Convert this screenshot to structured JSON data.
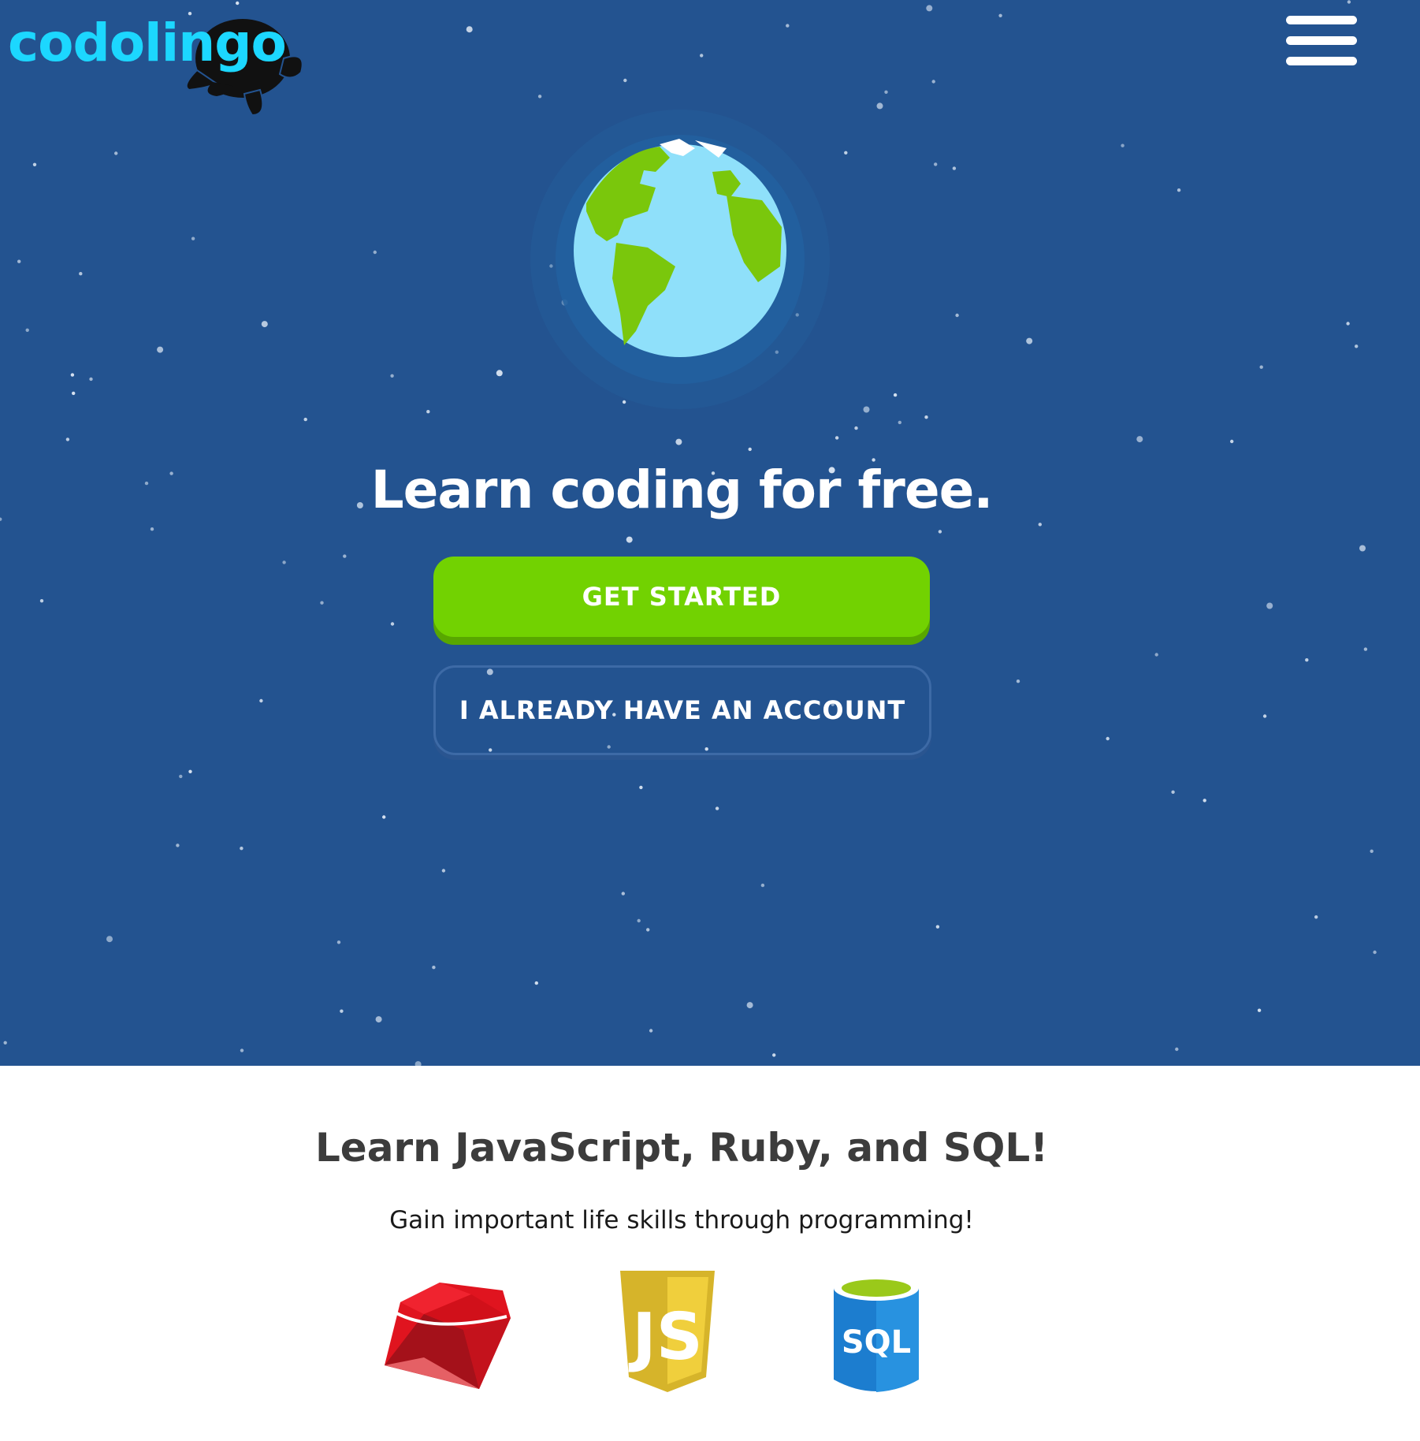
{
  "brand": {
    "name": "codolingo",
    "logo_icon": "turtle-icon"
  },
  "header": {
    "menu_icon": "hamburger-menu-icon"
  },
  "hero": {
    "illustration": "globe-icon",
    "title": "Learn coding for free.",
    "primary_button": "GET STARTED",
    "secondary_button": "I ALREADY HAVE AN ACCOUNT"
  },
  "features": {
    "title": "Learn JavaScript, Ruby, and SQL!",
    "subtitle": "Gain important life skills through programming!",
    "languages": [
      {
        "name": "Ruby",
        "icon": "ruby-gem-icon"
      },
      {
        "name": "JavaScript",
        "icon": "js-shield-icon",
        "badge_text": "JS"
      },
      {
        "name": "SQL",
        "icon": "sql-database-icon",
        "badge_text": "SQL"
      }
    ]
  },
  "colors": {
    "hero_background": "#235390",
    "brand_cyan": "#1cd7ff",
    "primary_green": "#72d201",
    "primary_green_shadow": "#58a700",
    "ocean": "#8fe0fa",
    "land": "#7ac70c",
    "heading_text": "#3c3c3c"
  }
}
